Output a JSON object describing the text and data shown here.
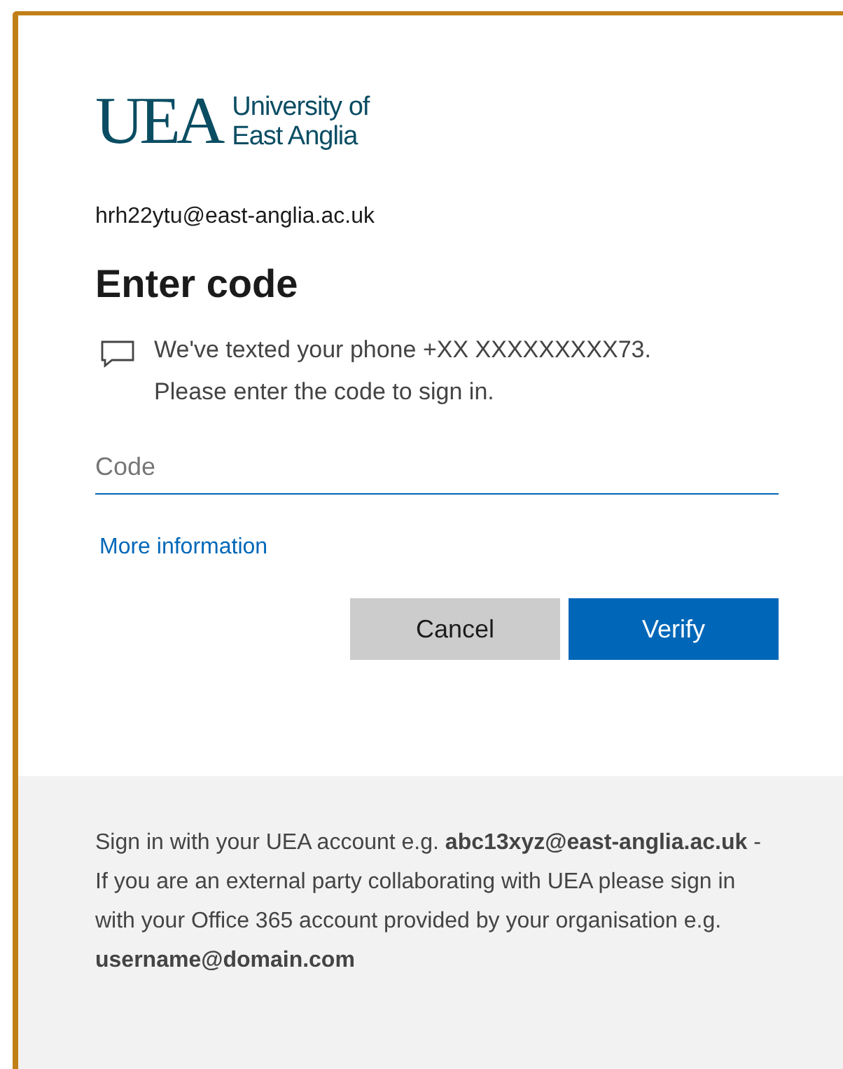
{
  "logo": {
    "mark": "UEA",
    "name_lines": [
      "University of",
      "East Anglia"
    ]
  },
  "account": "hrh22ytu@east-anglia.ac.uk",
  "title": "Enter code",
  "message": "We've texted your phone +XX XXXXXXXXX73. Please enter the code to sign in.",
  "code_field": {
    "placeholder": "Code"
  },
  "link": "More information",
  "buttons": [
    {
      "label": "Cancel",
      "kind": "secondary"
    },
    {
      "label": "Verify",
      "kind": "primary"
    }
  ],
  "footer": "Sign in with your UEA account e.g. **abc13xyz@east-anglia.ac.uk** - If you are an external party collaborating with UEA please sign in with your Office 365 account provided by your organisation e.g. **username@domain.com**"
}
